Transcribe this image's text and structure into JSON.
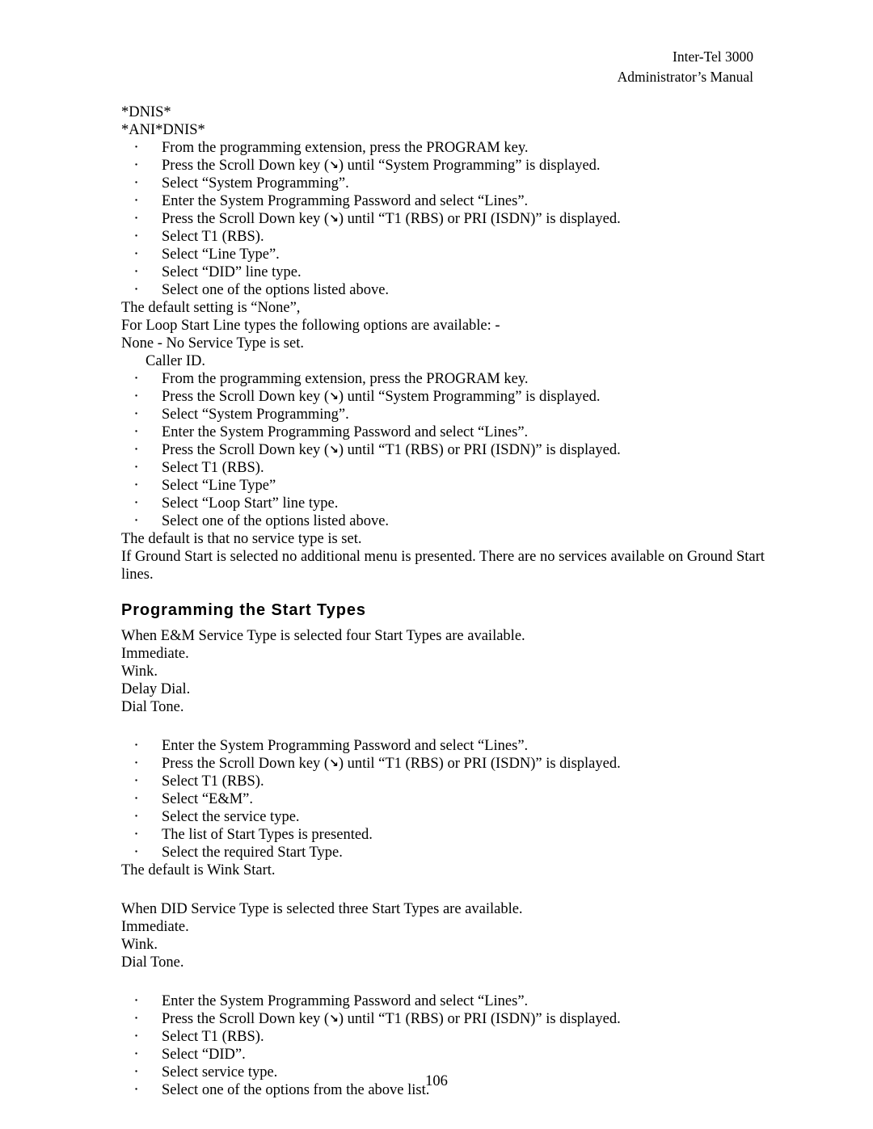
{
  "header": {
    "line1": "Inter-Tel 3000",
    "line2": "Administrator’s Manual"
  },
  "body": {
    "heading_dnis": "*DNIS*",
    "heading_anidnis": "*ANI*DNIS*",
    "list1": [
      {
        "pre": "From the programming extension, press the PROGRAM key.",
        "arrow": false,
        "post": ""
      },
      {
        "pre": "Press the Scroll Down key (",
        "arrow": true,
        "post": ") until “System Programming” is displayed."
      },
      {
        "pre": "Select “System Programming”.",
        "arrow": false,
        "post": ""
      },
      {
        "pre": "Enter the System Programming Password and select “Lines”.",
        "arrow": false,
        "post": ""
      },
      {
        "pre": "Press the Scroll Down key (",
        "arrow": true,
        "post": ") until “T1 (RBS) or PRI (ISDN)” is displayed."
      },
      {
        "pre": "Select T1 (RBS).",
        "arrow": false,
        "post": ""
      },
      {
        "pre": "Select “Line Type”.",
        "arrow": false,
        "post": ""
      },
      {
        "pre": "Select “DID” line type.",
        "arrow": false,
        "post": ""
      },
      {
        "pre": "Select one of the options listed above.",
        "arrow": false,
        "post": ""
      }
    ],
    "para1": "The default setting is “None”,",
    "para2": "For Loop Start Line types the following options are available: -",
    "para3": "None - No Service Type is set.",
    "para4": "Caller ID.",
    "list2": [
      {
        "pre": "From the programming extension, press the PROGRAM key.",
        "arrow": false,
        "post": ""
      },
      {
        "pre": "Press the Scroll Down key (",
        "arrow": true,
        "post": ") until “System Programming” is displayed."
      },
      {
        "pre": "Select “System Programming”.",
        "arrow": false,
        "post": ""
      },
      {
        "pre": "Enter the System Programming Password and select “Lines”.",
        "arrow": false,
        "post": ""
      },
      {
        "pre": "Press the Scroll Down key (",
        "arrow": true,
        "post": ") until “T1 (RBS) or PRI (ISDN)” is displayed."
      },
      {
        "pre": "Select T1 (RBS).",
        "arrow": false,
        "post": ""
      },
      {
        "pre": "Select “Line Type”",
        "arrow": false,
        "post": ""
      },
      {
        "pre": "Select “Loop Start” line type.",
        "arrow": false,
        "post": ""
      },
      {
        "pre": "Select one of the options listed above.",
        "arrow": false,
        "post": ""
      }
    ],
    "para5": "The default is that no service type is set.",
    "para6": "If Ground Start is selected no additional menu is presented. There are no services available on Ground Start lines.",
    "section_title": "Programming the Start Types",
    "para7": "When E&M Service Type is selected four Start Types are available.",
    "para8": "Immediate.",
    "para9": "Wink.",
    "para10": "Delay Dial.",
    "para11": "Dial Tone.",
    "list3": [
      {
        "pre": "Enter the System Programming Password and select “Lines”.",
        "arrow": false,
        "post": ""
      },
      {
        "pre": "Press the Scroll Down key (",
        "arrow": true,
        "post": ") until “T1 (RBS) or PRI (ISDN)” is displayed."
      },
      {
        "pre": "Select T1 (RBS).",
        "arrow": false,
        "post": ""
      },
      {
        "pre": "Select “E&M”.",
        "arrow": false,
        "post": ""
      },
      {
        "pre": "Select the service type.",
        "arrow": false,
        "post": ""
      },
      {
        "pre": "The list of Start Types is presented.",
        "arrow": false,
        "post": ""
      },
      {
        "pre": "Select the required Start Type.",
        "arrow": false,
        "post": ""
      }
    ],
    "para12": "The default is Wink Start.",
    "para13": "When DID Service Type is selected three Start Types are available.",
    "para14": "Immediate.",
    "para15": "Wink.",
    "para16": "Dial Tone.",
    "list4": [
      {
        "pre": "Enter the System Programming Password and select “Lines”.",
        "arrow": false,
        "post": ""
      },
      {
        "pre": "Press the Scroll Down key (",
        "arrow": true,
        "post": ") until “T1 (RBS) or PRI (ISDN)” is displayed."
      },
      {
        "pre": "Select T1 (RBS).",
        "arrow": false,
        "post": ""
      },
      {
        "pre": "Select “DID”.",
        "arrow": false,
        "post": ""
      },
      {
        "pre": "Select service type.",
        "arrow": false,
        "post": ""
      },
      {
        "pre": "Select one of the options from the above list.",
        "arrow": false,
        "post": ""
      }
    ]
  },
  "footer": {
    "page_number": "106"
  },
  "icons": {
    "scroll_down_key": "↘"
  }
}
